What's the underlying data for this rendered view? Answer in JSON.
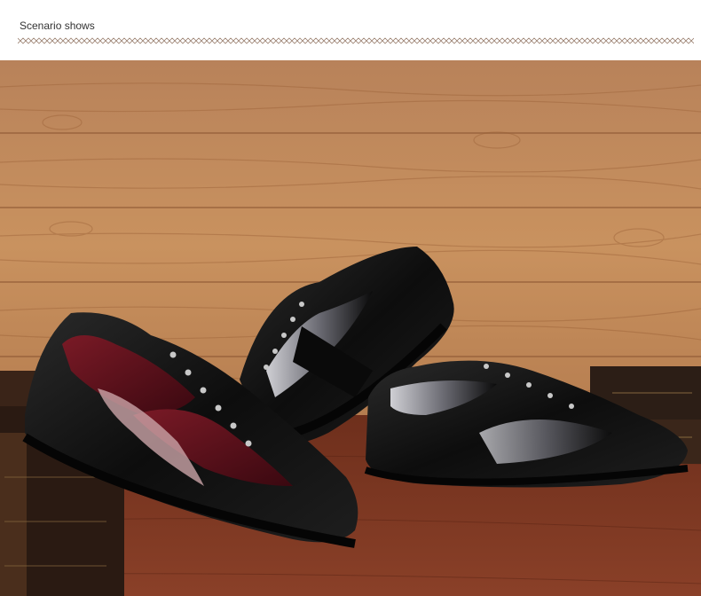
{
  "header": {
    "title": "Scenario shows"
  },
  "colors": {
    "background": "#ffffff",
    "title_text": "#333333",
    "divider": "#9a8070",
    "wood_light": "#c38a5a",
    "wood_dark": "#8a5430",
    "table": "#7a3a24",
    "shoe_black": "#141414",
    "shoe_burgundy": "#5a0f1a"
  },
  "photo": {
    "subject": "three-leather-sneakers-on-wood"
  }
}
